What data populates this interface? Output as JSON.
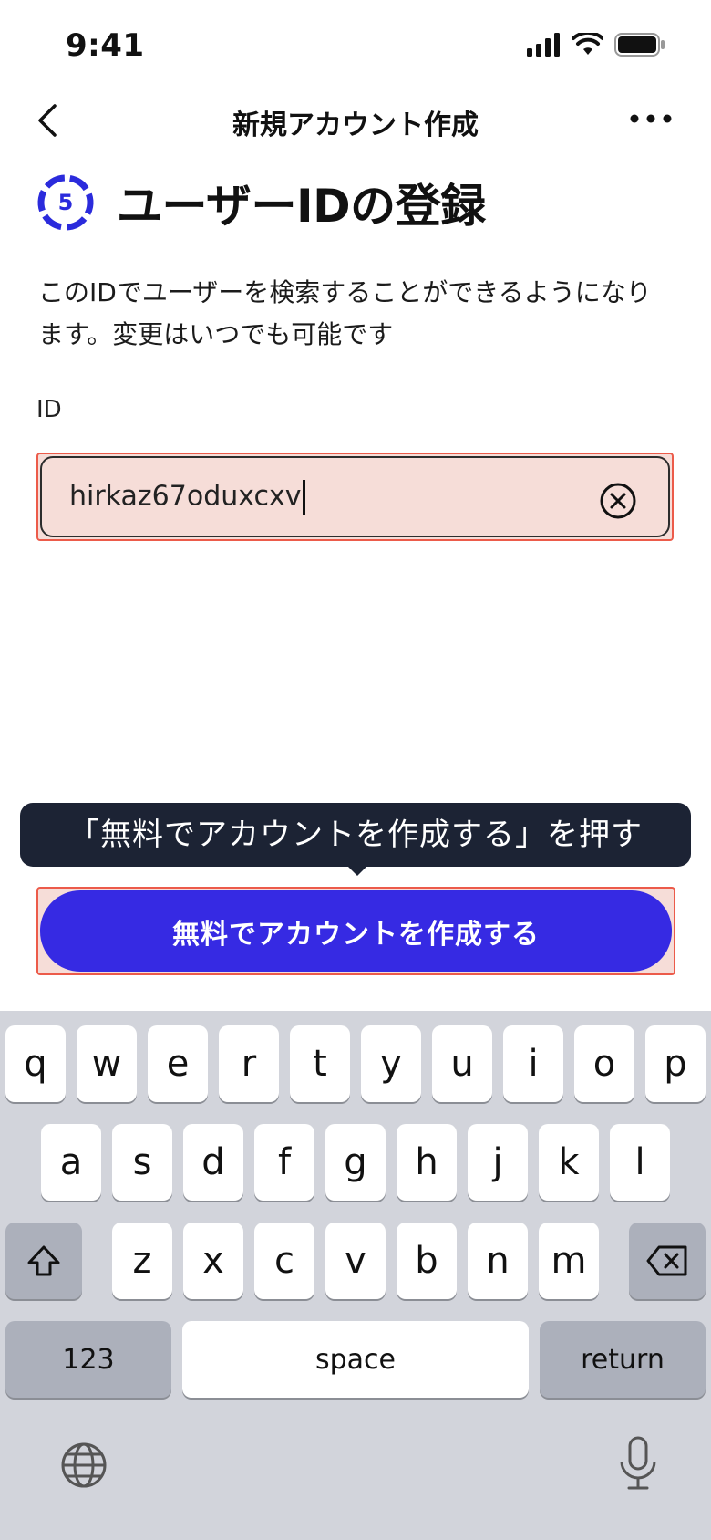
{
  "status_bar": {
    "time": "9:41"
  },
  "nav": {
    "title": "新規アカウント作成"
  },
  "heading": {
    "step": "5",
    "title": "ユーザーIDの登録"
  },
  "description": "このIDでユーザーを検索することができるようになります。変更はいつでも可能です",
  "field": {
    "label": "ID",
    "value": "hirkaz67oduxcxv"
  },
  "tooltip": "「無料でアカウントを作成する」を押す",
  "cta": {
    "label": "無料でアカウントを作成する"
  },
  "keyboard": {
    "row1": [
      "q",
      "w",
      "e",
      "r",
      "t",
      "y",
      "u",
      "i",
      "o",
      "p"
    ],
    "row2": [
      "a",
      "s",
      "d",
      "f",
      "g",
      "h",
      "j",
      "k",
      "l"
    ],
    "row3": [
      "z",
      "x",
      "c",
      "v",
      "b",
      "n",
      "m"
    ],
    "numbers": "123",
    "space": "space",
    "return": "return"
  },
  "colors": {
    "accent": "#362ae3",
    "highlight_border": "#ec5b4a",
    "highlight_fill": "#f6ddd8",
    "tooltip_bg": "#1c2334"
  }
}
